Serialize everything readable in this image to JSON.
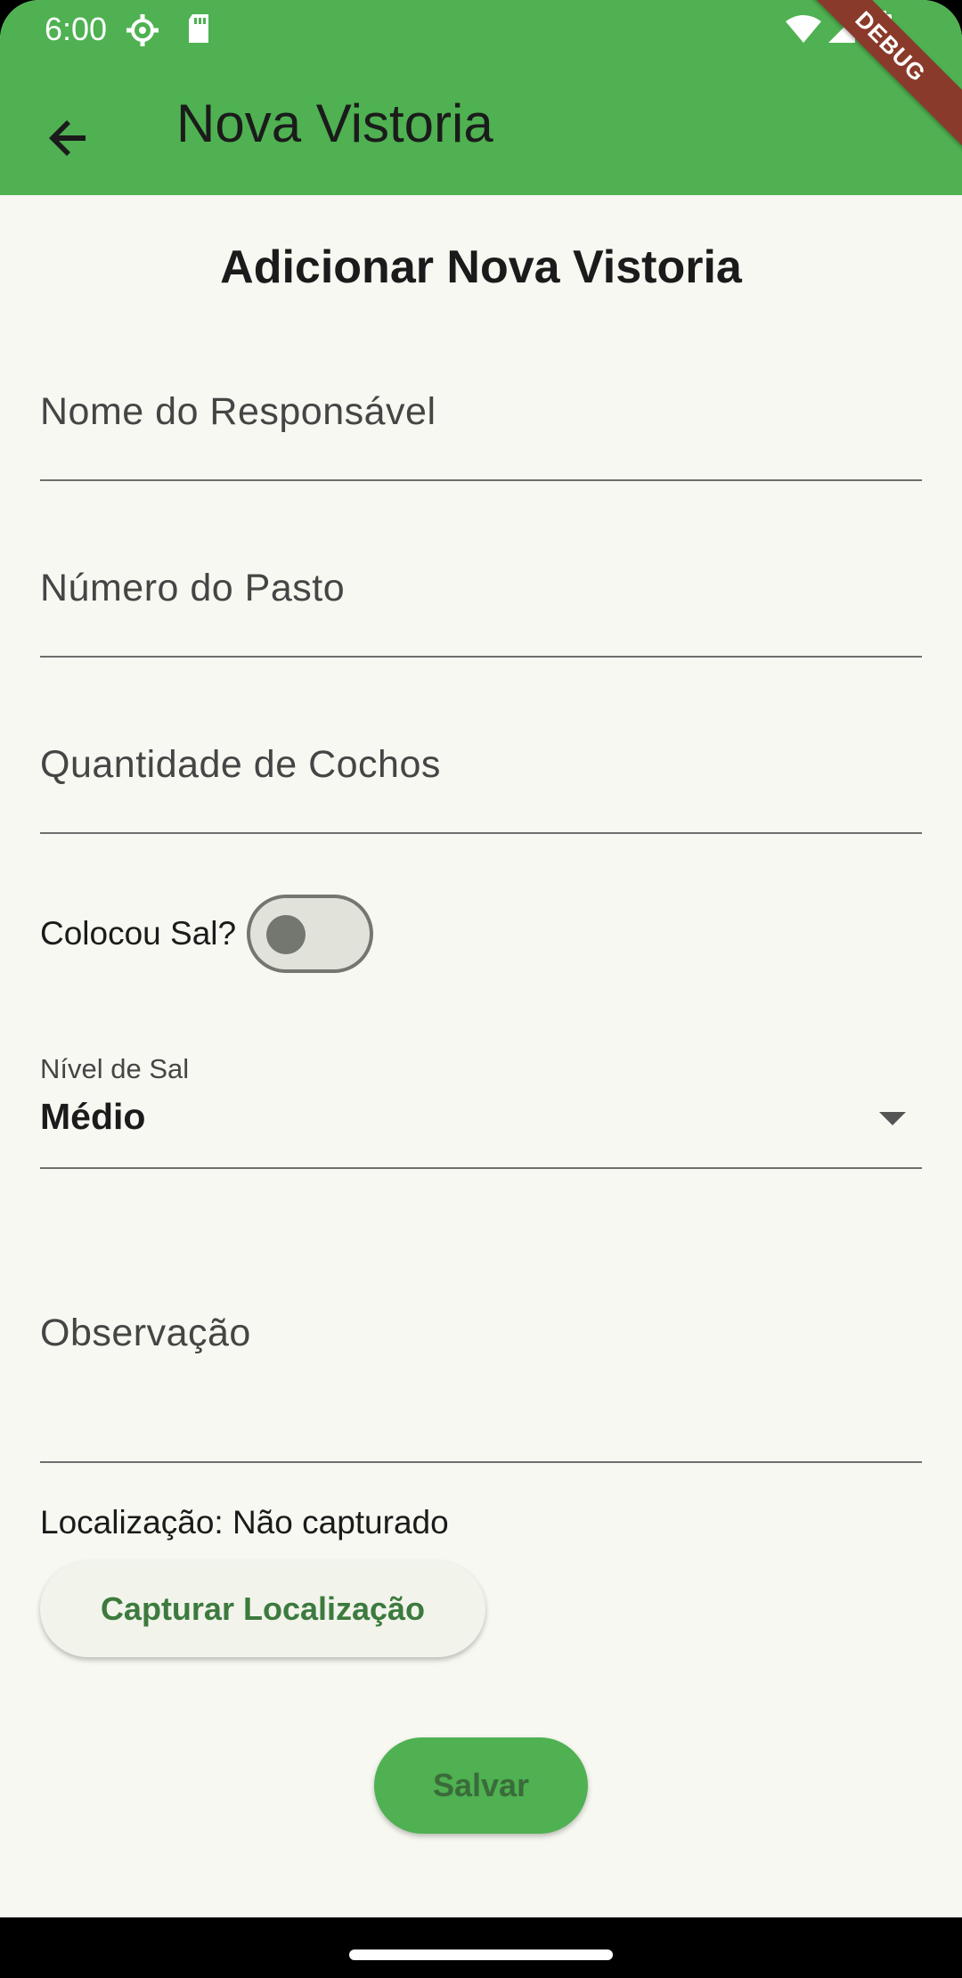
{
  "status_bar": {
    "time": "6:00",
    "left_icons": [
      "gear-icon",
      "sd-card-icon"
    ],
    "right_icons": [
      "wifi-icon",
      "signal-icon",
      "battery-icon"
    ]
  },
  "debug_banner": "DEBUG",
  "app_bar": {
    "back_icon": "arrow-back-icon",
    "title": "Nova Vistoria",
    "color": "#4fb151"
  },
  "form": {
    "heading": "Adicionar Nova Vistoria",
    "responsavel_label": "Nome do Responsável",
    "pasto_label": "Número do Pasto",
    "cochos_label": "Quantidade de Cochos",
    "sal_switch": {
      "label": "Colocou Sal?",
      "on": false
    },
    "nivel_sal": {
      "label": "Nível de Sal",
      "value": "Médio"
    },
    "observacao_label": "Observação",
    "localizacao_text": "Localização: Não capturado",
    "capture_button": "Capturar Localização",
    "save_button": "Salvar"
  },
  "colors": {
    "primary": "#4fb151",
    "background": "#f6f8f1",
    "button_text": "#3c7a3d"
  }
}
